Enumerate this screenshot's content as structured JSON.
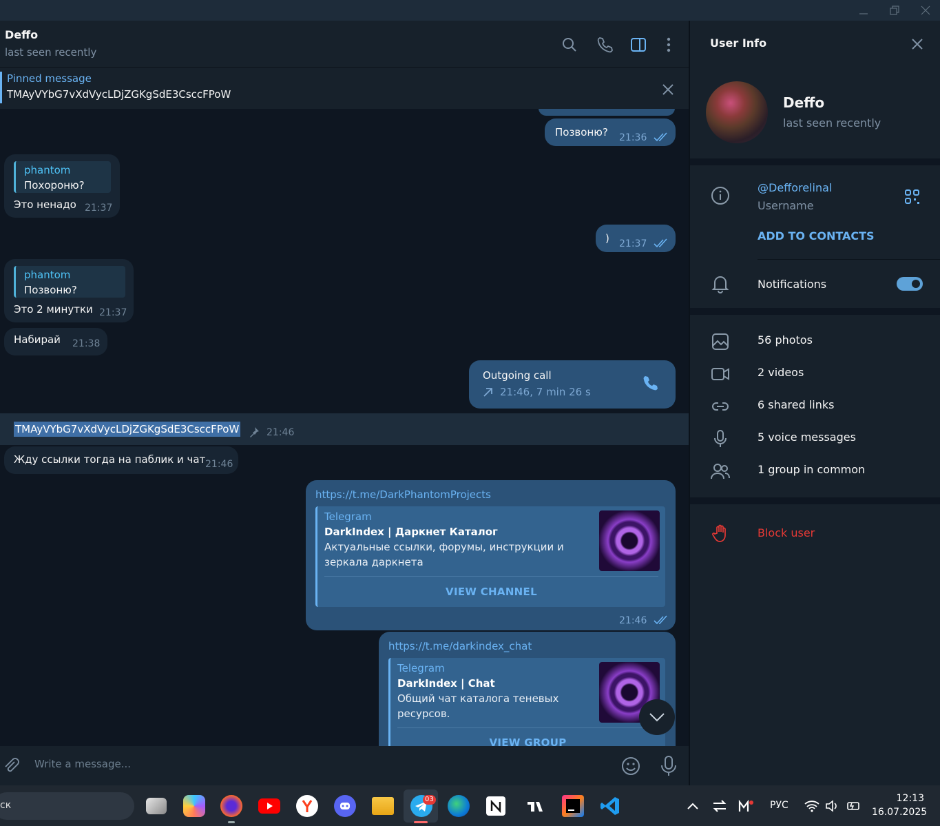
{
  "chat": {
    "name": "Deffo",
    "status": "last seen recently",
    "pinned_title": "Pinned message",
    "pinned_text": "TMAyVYbG7vXdVycLDjZGKgSdE3CsccFPoW"
  },
  "messages": {
    "m1_text": "Позвоню?",
    "m1_time": "21:36",
    "m2_reply_name": "phantom",
    "m2_reply_text": "Похороню?",
    "m2_text": "Это ненадо",
    "m2_time": "21:37",
    "m3_text": ")",
    "m3_time": "21:37",
    "m4_reply_name": "phantom",
    "m4_reply_text": "Позвоню?",
    "m4_text": "Это 2 минутки",
    "m4_time": "21:37",
    "m5_text": "Набирай",
    "m5_time": "21:38",
    "call_title": "Outgoing call",
    "call_details": "21:46, 7 min 26 s",
    "m6_text": "TMAyVYbG7vXdVycLDjZGKgSdE3CsccFPoW",
    "m6_time": "21:46",
    "m7_text": "Жду ссылки тогда на паблик и чат",
    "m7_time": "21:46",
    "link1_url": "https://t.me/DarkPhantomProjects",
    "link1_site": "Telegram",
    "link1_title": "DarkIndex | Даркнет Каталог",
    "link1_desc": "Актуальные ссылки, форумы, инструкции и зеркала даркнета",
    "link1_button": "VIEW CHANNEL",
    "link1_time": "21:46",
    "link2_url": "https://t.me/darkindex_chat",
    "link2_site": "Telegram",
    "link2_title": "DarkIndex | Chat",
    "link2_desc": "Общий чат каталога теневых ресурсов.",
    "link2_button": "VIEW GROUP"
  },
  "input": {
    "placeholder": "Write a message..."
  },
  "user_info": {
    "title": "User Info",
    "name": "Deffo",
    "status": "last seen recently",
    "username": "@Defforelinal",
    "username_label": "Username",
    "add_contacts": "ADD TO CONTACTS",
    "notifications": "Notifications",
    "notifications_on": true,
    "photos": "56 photos",
    "videos": "2 videos",
    "links": "6 shared links",
    "voice": "5 voice messages",
    "groups": "1 group in common",
    "block": "Block user"
  },
  "taskbar": {
    "search_text": "ск",
    "telegram_badge": "03",
    "language": "РУС",
    "time": "12:13",
    "date": "16.07.2025"
  },
  "colors": {
    "accent": "#6ab3f3",
    "bg": "#0e1621",
    "panel": "#17212b",
    "outgoing": "#2b5278",
    "incoming": "#182533",
    "danger": "#e53935"
  }
}
